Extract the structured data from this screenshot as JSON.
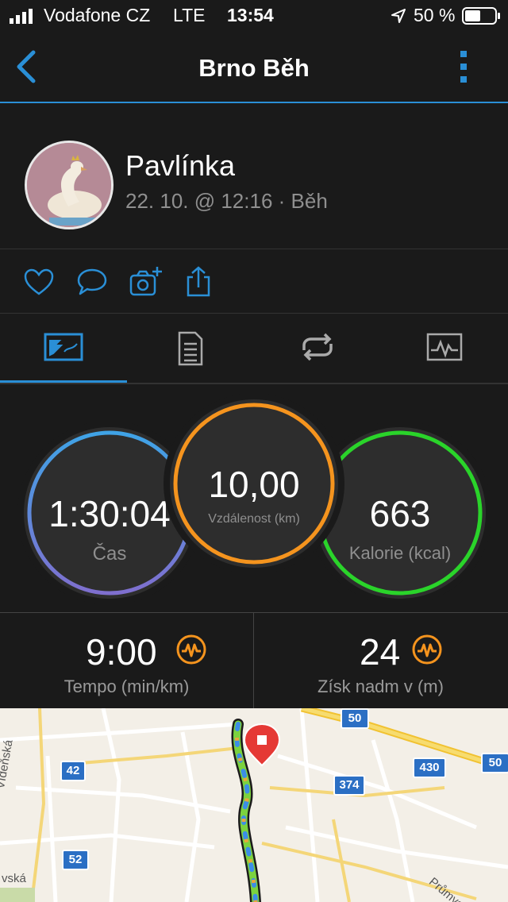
{
  "status": {
    "carrier": "Vodafone CZ",
    "network": "LTE",
    "time": "13:54",
    "battery": "50 %"
  },
  "nav": {
    "title": "Brno Běh"
  },
  "activity": {
    "user": "Pavlínka",
    "subtitle": "22. 10. @ 12:16 · Běh"
  },
  "stats": {
    "time": {
      "value": "1:30:04",
      "label": "Čas"
    },
    "distance": {
      "value": "10,00",
      "label": "Vzdálenost (km)"
    },
    "calories": {
      "value": "663",
      "label": "Kalorie (kcal)"
    }
  },
  "metrics": {
    "pace": {
      "value": "9:00",
      "label": "Tempo (min/km)"
    },
    "elevation": {
      "value": "24",
      "label": "Získ nadm v (m)"
    }
  },
  "map": {
    "road_labels": [
      "50",
      "42",
      "374",
      "430",
      "50",
      "52"
    ],
    "street_labels": [
      "Vídeňská",
      "vská",
      "Průmysl"
    ]
  },
  "colors": {
    "accent": "#2a8fd6",
    "time_ring": "#5a8fe0",
    "distance_ring": "#f5941e",
    "calories_ring": "#2ad42a"
  }
}
